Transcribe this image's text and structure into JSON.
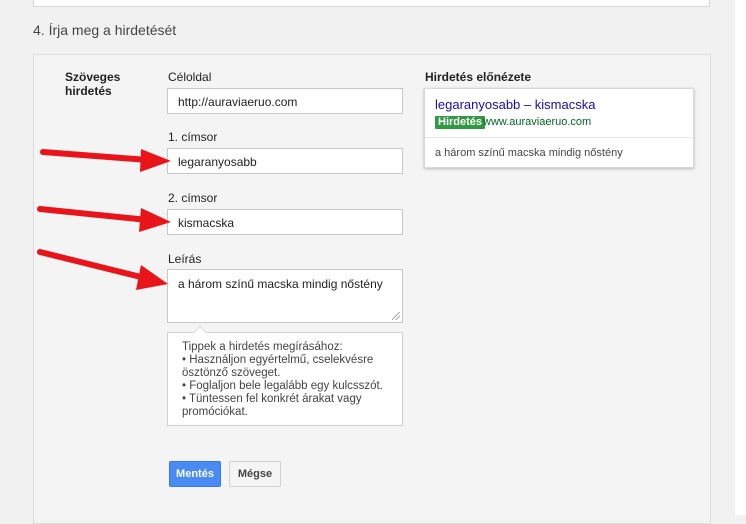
{
  "step_title": "4. Írja meg a hirdetését",
  "ad_type_label": "Szöveges hirdetés",
  "fields": {
    "landing_page": {
      "label": "Céloldal",
      "value": "http://auraviaeruo.com"
    },
    "headline1": {
      "label": "1. címsor",
      "value": "legaranyosabb"
    },
    "headline2": {
      "label": "2. címsor",
      "value": "kismacska"
    },
    "description": {
      "label": "Leírás",
      "value": "a három színű macska mindig nőstény"
    }
  },
  "tips": {
    "title": "Tippek a hirdetés megírásához:",
    "items": [
      "• Használjon egyértelmű, cselekvésre",
      "ösztönző szöveget.",
      "• Foglaljon bele legalább egy kulcsszót.",
      "• Tüntessen fel konkrét árakat vagy",
      "promóciókat."
    ]
  },
  "buttons": {
    "save": "Mentés",
    "cancel": "Mégse"
  },
  "preview": {
    "label": "Hirdetés előnézete",
    "headline": "legaranyosabb – kismacska",
    "badge": "Hirdetés",
    "display_url": "www.auraviaeruo.com",
    "description": "a három színű macska mindig nőstény"
  },
  "colors": {
    "accent_button": "#4a8af4",
    "headline_link": "#1a0dab",
    "ad_badge": "#2f9a41",
    "display_url": "#006621",
    "annotation_arrow": "#e8141a"
  },
  "icons": {
    "annotation_arrows": "red-arrow-icon"
  }
}
